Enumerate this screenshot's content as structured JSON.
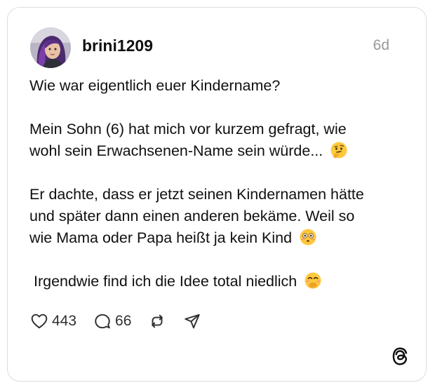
{
  "post": {
    "author": {
      "username": "brini1209",
      "avatar_icon": "profile-photo"
    },
    "time_ago": "6d",
    "paragraphs": [
      {
        "lines": [
          "Wie war eigentlich euer Kindername?"
        ]
      },
      {
        "lines": [
          "Mein Sohn (6) hat mich vor kurzem gefragt, wie",
          "wohl sein Erwachsenen-Name sein würde..."
        ],
        "emoji": "thinking-face"
      },
      {
        "lines": [
          "Er dachte, dass er jetzt seinen Kindernamen hätte",
          "und später dann einen anderen bekäme. Weil so",
          "wie Mama oder Papa heißt ja kein Kind"
        ],
        "emoji": "flushed-face"
      },
      {
        "lines": [
          " Irgendwie find ich die Idee total niedlich"
        ],
        "emoji": "hand-over-mouth-face"
      }
    ],
    "stats": {
      "likes": "443",
      "replies": "66"
    },
    "actions": [
      "like",
      "reply",
      "repost",
      "share"
    ]
  },
  "branding": {
    "logo": "threads-logo"
  },
  "colors": {
    "text": "#101010",
    "muted": "#999999",
    "border": "#dcdcdc",
    "emoji_yellow": "#FFC83D"
  }
}
